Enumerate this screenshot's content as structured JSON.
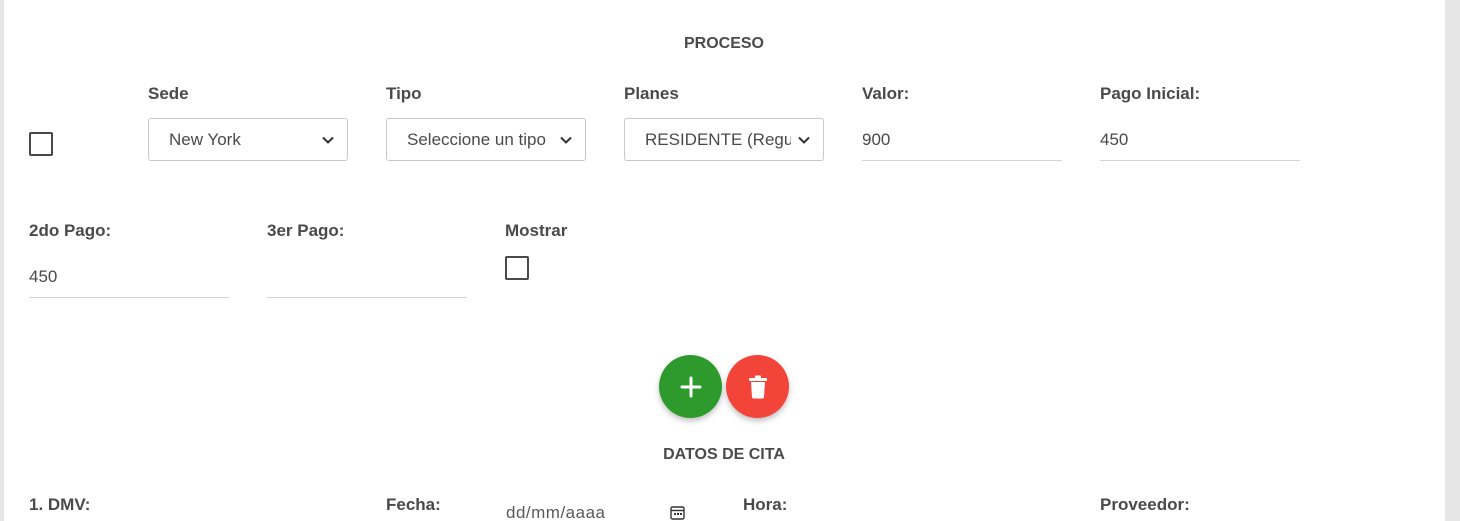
{
  "proceso": {
    "title": "PROCESO",
    "sede": {
      "label": "Sede",
      "value": "New York"
    },
    "tipo": {
      "label": "Tipo",
      "value": "Seleccione un tipo"
    },
    "planes": {
      "label": "Planes",
      "value": "RESIDENTE (Regul"
    },
    "valor": {
      "label": "Valor:",
      "value": "900"
    },
    "pago_inicial": {
      "label": "Pago Inicial:",
      "value": "450"
    },
    "segundo_pago": {
      "label": "2do Pago:",
      "value": "450"
    },
    "tercer_pago": {
      "label": "3er Pago:",
      "value": ""
    },
    "mostrar": {
      "label": "Mostrar"
    }
  },
  "actions": {
    "add_icon": "plus-icon",
    "delete_icon": "trash-icon",
    "add_color": "#2e9a2e",
    "delete_color": "#f24438"
  },
  "datos_cita": {
    "title": "DATOS DE CITA",
    "dmv_label": "1. DMV:",
    "fecha_label": "Fecha:",
    "fecha_placeholder": "dd/mm/aaaa",
    "hora_label": "Hora:",
    "proveedor_label": "Proveedor:"
  }
}
